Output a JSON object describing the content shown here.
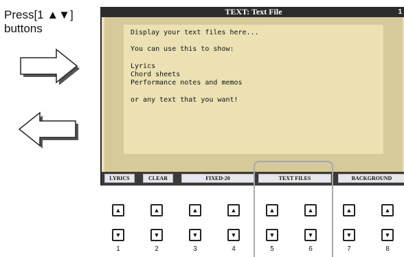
{
  "annotation": {
    "text": "Press[1 ▲▼]\nbuttons"
  },
  "screen": {
    "title": "TEXT: Text File",
    "page_number": "1",
    "lines": [
      "Display your text files here...",
      "",
      "You can use this to show:",
      "",
      "Lyrics",
      "Chord sheets",
      "Performance notes and memos",
      "",
      "or any text that you want!"
    ]
  },
  "softkeys": [
    "LYRICS",
    "CLEAR",
    "FIXED-20",
    "TEXT FILES",
    "BACKGROUND"
  ],
  "hardware": {
    "up_symbol": "▲",
    "down_symbol": "▼",
    "numbers": [
      "1",
      "2",
      "3",
      "4",
      "5",
      "6",
      "7",
      "8"
    ]
  }
}
